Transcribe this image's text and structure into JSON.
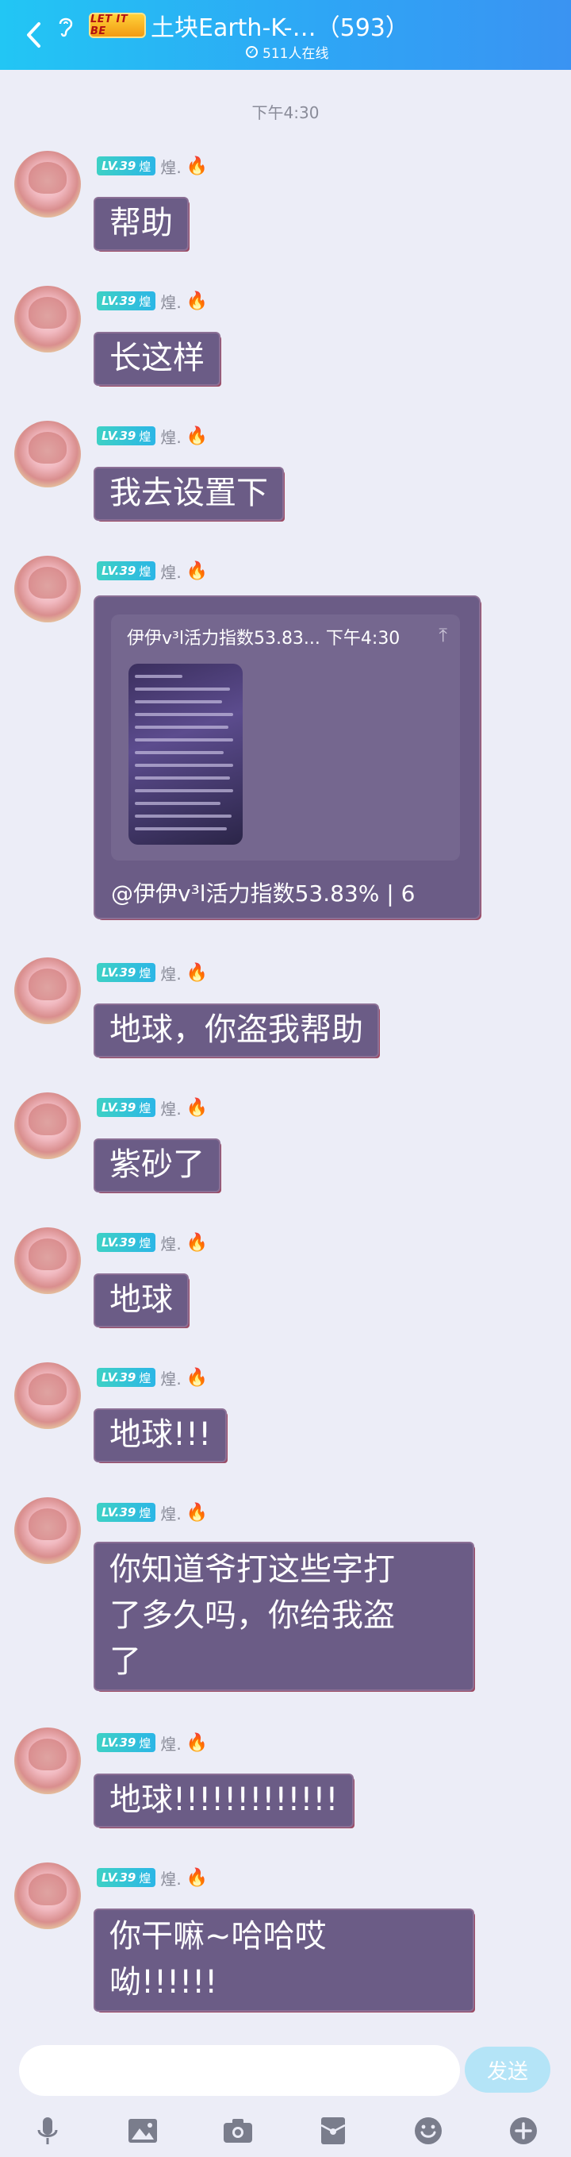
{
  "header": {
    "back_icon": "chevron-left-icon",
    "ear_icon": "ear-icon",
    "badge_text": "LET IT BE",
    "title": "土块Earth-K-…（593）",
    "online_text": "511人在线"
  },
  "timestamp": "下午4:30",
  "sender": {
    "level": "LV.39",
    "level_tag": "煌",
    "nick": "煌.",
    "fire_icon": "fire-icon"
  },
  "messages": [
    {
      "text": "帮助"
    },
    {
      "text": "长这样"
    },
    {
      "text": "我去设置下"
    },
    {
      "card_head": "伊伊v³l活力指数53.83... 下午4:30",
      "card_foot": "@伊伊v³l活力指数53.83% |  6"
    },
    {
      "text": "地球，你盗我帮助"
    },
    {
      "text": "紫砂了"
    },
    {
      "text": "地球"
    },
    {
      "text": "地球!!!"
    },
    {
      "line1": "你知道爷打这些字打",
      "line2": "了多久吗，你给我盗",
      "line3": "了"
    },
    {
      "text": "地球!!!!!!!!!!!!!"
    },
    {
      "line1": "你干嘛~哈哈哎",
      "line2": "呦!!!!!!"
    }
  ],
  "input": {
    "placeholder": "",
    "send_label": "发送"
  },
  "toolbar": {
    "icons": [
      "microphone-icon",
      "image-icon",
      "camera-icon",
      "red-packet-icon",
      "emoji-icon",
      "plus-icon"
    ]
  }
}
